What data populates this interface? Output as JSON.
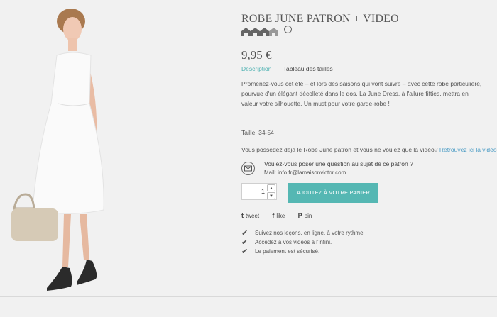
{
  "product": {
    "title": "ROBE JUNE PATRON + VIDEO",
    "level_icon": "difficulty-level-house-icons",
    "level_info_icon": "i",
    "price": "9,95 €"
  },
  "tabs": {
    "description": "Description",
    "sizes": "Tableau des tailles"
  },
  "description": "Promenez-vous cet été – et lors des saisons qui vont suivre – avec cette robe particulière, pourvue d'un élégant décolleté dans le dos. La June Dress, à l'allure fifties, mettra en valeur votre silhouette. Un must pour votre garde-robe !",
  "sizes": "Taille: 34-54",
  "video": {
    "text": "Vous possédez déjà le Robe June patron et vous ne voulez que la vidéo?",
    "link": "Retrouvez ici la vidéo seule."
  },
  "question": {
    "link": "Voulez-vous poser une question au sujet de ce patron ?",
    "mail": "Mail: info.fr@lamaisonvictor.com",
    "icon": "mail-icon"
  },
  "cart": {
    "quantity": "1",
    "button": "AJOUTEZ À VOTRE PANIER",
    "up": "▲",
    "down": "▼"
  },
  "social": {
    "tweet": "tweet",
    "like": "like",
    "pin": "pin",
    "tweet_icon": "t",
    "like_icon": "f",
    "pin_icon": "P"
  },
  "features": [
    "Suivez nos leçons, en ligne, à votre rythme.",
    "Accédez à vos vidéos à l'infini.",
    "Le paiement est sécurisé."
  ],
  "check_glyph": "✔",
  "colors": {
    "accent": "#55b7b3",
    "link": "#4a9bc4",
    "tab_active": "#4ab0b0",
    "background": "#f1f1f1"
  }
}
